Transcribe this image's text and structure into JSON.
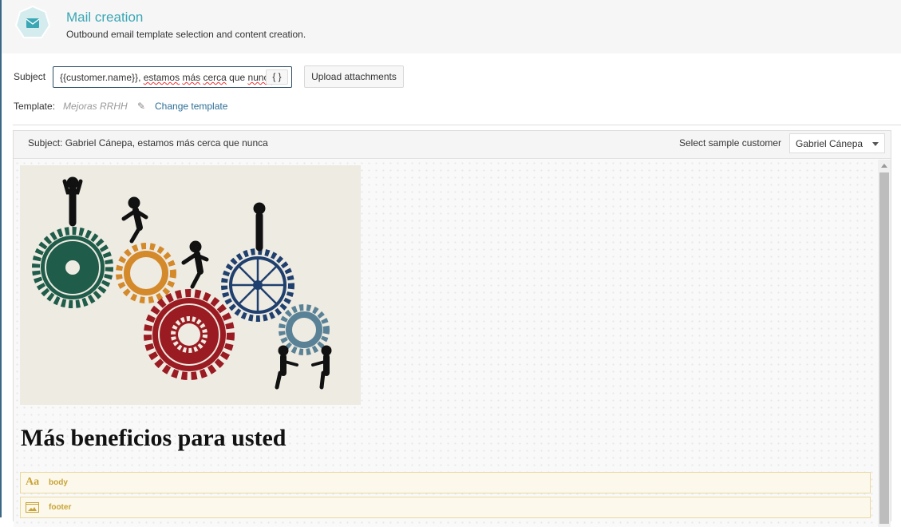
{
  "header": {
    "title": "Mail creation",
    "subtitle": "Outbound email template selection and content creation.",
    "icon": "envelope-icon"
  },
  "form": {
    "subject_label": "Subject",
    "subject_value_parts": [
      "{{customer.name}}, ",
      "estamos",
      " ",
      "más",
      " ",
      "cerca",
      " que ",
      "nunca"
    ],
    "variable_button": "{ }",
    "upload_label": "Upload attachments",
    "template_label": "Template:",
    "template_name": "Mejoras RRHH",
    "change_template": "Change template"
  },
  "preview": {
    "subject": "Subject: Gabriel Cánepa, estamos más cerca que nunca",
    "sample_label": "Select sample customer",
    "sample_value": "Gabriel Cánepa",
    "heading": "Más beneficios para usted",
    "blocks": [
      {
        "icon": "Aa",
        "name": "body"
      },
      {
        "icon": "image-icon",
        "name": "footer"
      }
    ]
  },
  "colors": {
    "accent": "#3aa7b5",
    "link": "#2d6f96",
    "block": "#c9a334"
  }
}
